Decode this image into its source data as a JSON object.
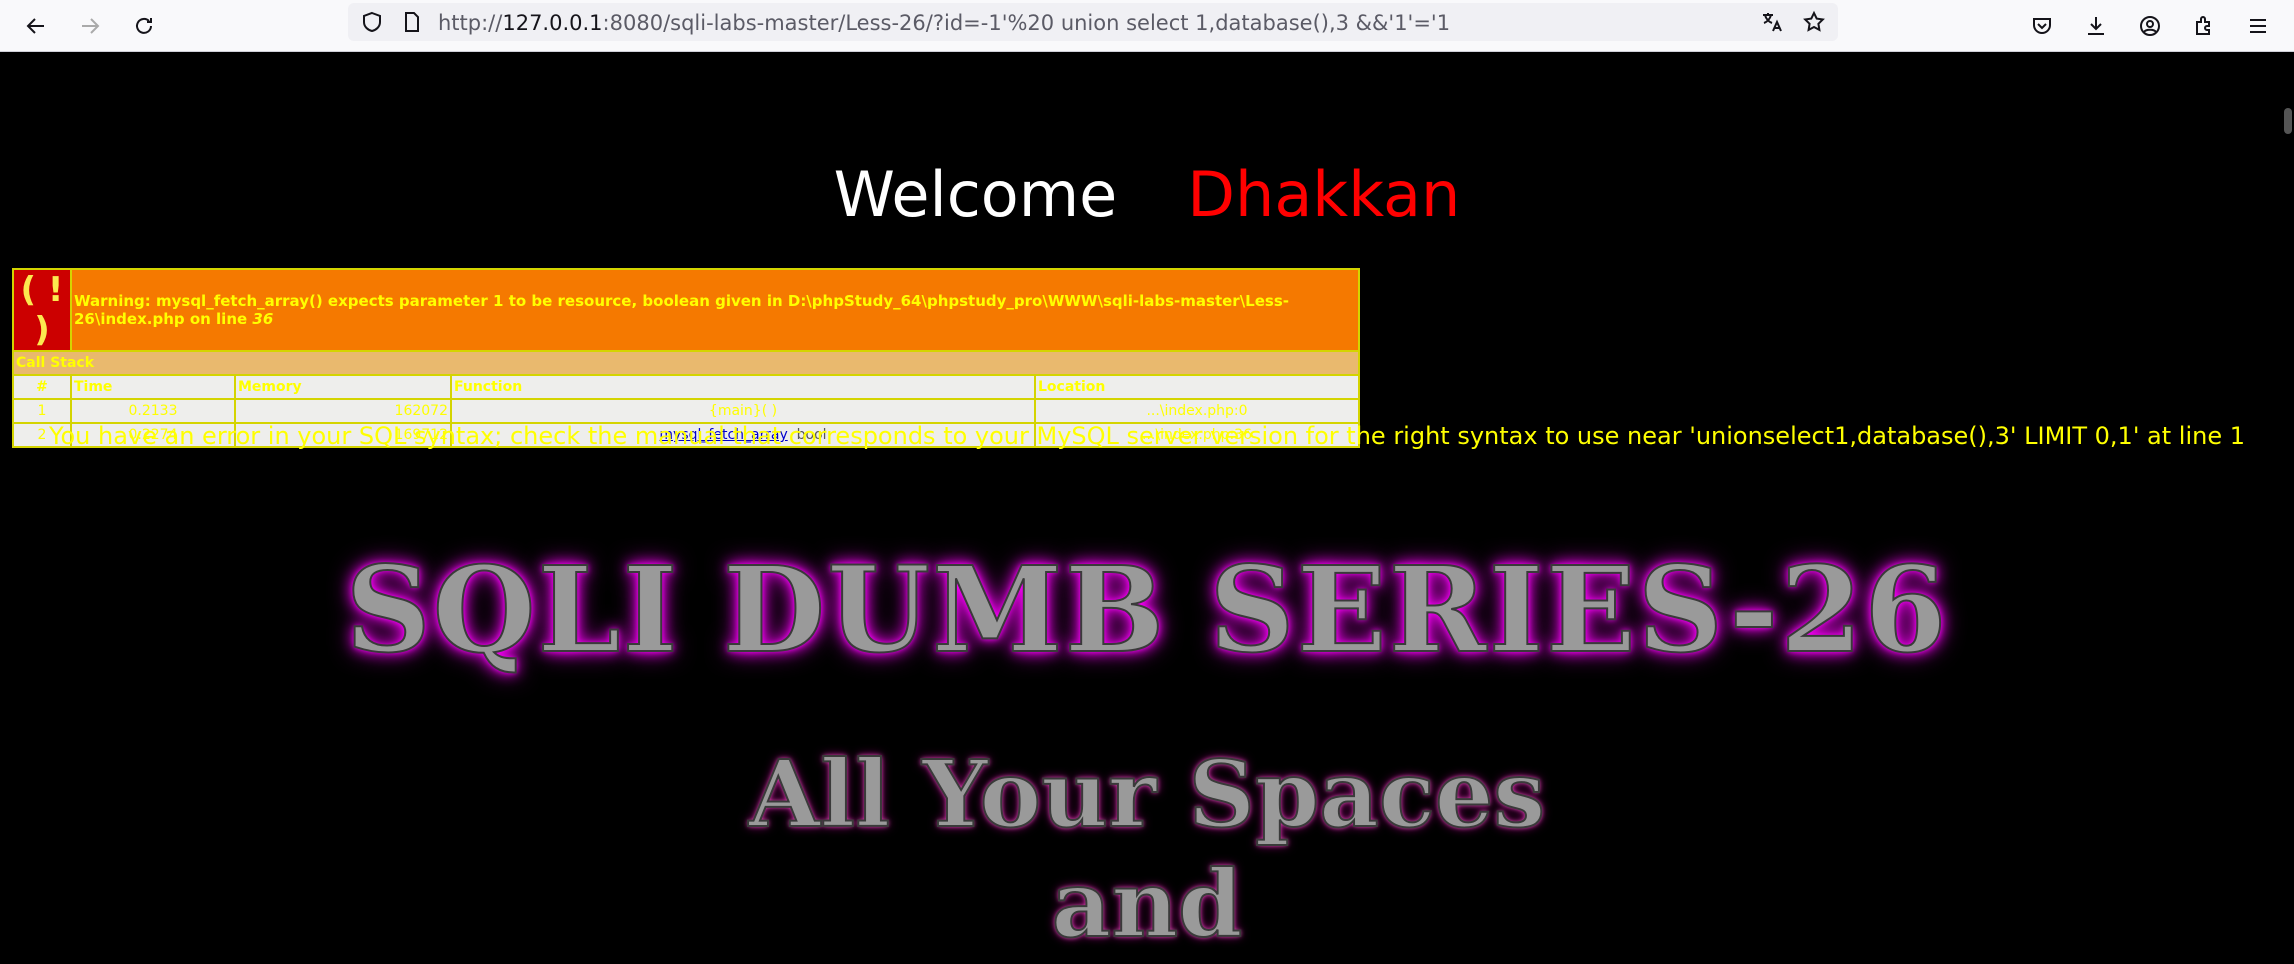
{
  "browser": {
    "url_prefix": "http://",
    "url_host": "127.0.0.1",
    "url_rest": ":8080/sqli-labs-master/Less-26/?id=-1'%20 union select 1,database(),3 &&'1'='1"
  },
  "page": {
    "welcome": "Welcome",
    "name": "Dhakkan",
    "warning_symbol": "( ! )",
    "warning_text": "Warning: mysql_fetch_array() expects parameter 1 to be resource, boolean given in D:\\phpStudy_64\\phpstudy_pro\\WWW\\sqli-labs-master\\Less-26\\index.php on line ",
    "warning_line": "36",
    "call_stack_label": "Call Stack",
    "headers": [
      "#",
      "Time",
      "Memory",
      "Function",
      "Location"
    ],
    "rows": [
      {
        "n": "1",
        "time": "0.2133",
        "memory": "162072",
        "function": "{main}( )",
        "location": "...\\index.php:0"
      },
      {
        "n": "2",
        "time": "0.2274",
        "memory": "169712",
        "function": "mysql_fetch_array",
        "arg": "bool",
        "location": "...\\index.php:36"
      }
    ],
    "sql_error": "You have an error in your SQL syntax; check the manual that corresponds to your MySQL server version for the right syntax to use near 'unionselect1,database(),3' LIMIT 0,1' at line 1",
    "title1": "SQLI DUMB SERIES-26",
    "title2": "All Your Spaces",
    "title3": "and"
  }
}
